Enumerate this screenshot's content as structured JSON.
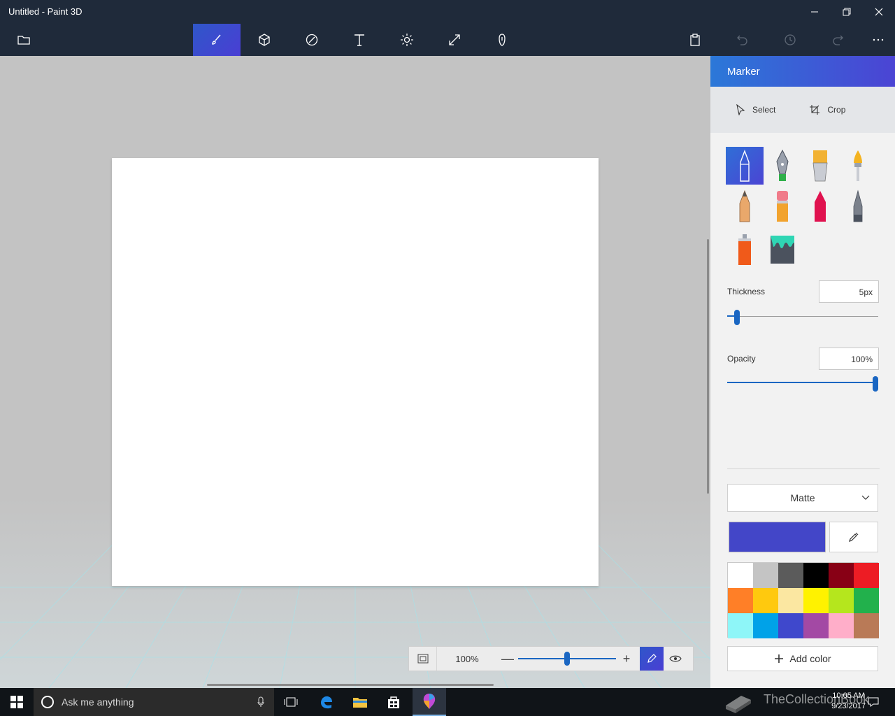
{
  "window": {
    "title": "Untitled - Paint 3D",
    "minimize_icon": "minimize-icon",
    "restore_icon": "restore-icon",
    "close_icon": "close-icon"
  },
  "toolbar": {
    "menu_icon": "folder-icon",
    "tools": [
      "brushes-icon",
      "3d-shapes-icon",
      "stickers-icon",
      "text-icon",
      "effects-icon",
      "canvas-icon",
      "remix3d-icon"
    ],
    "active_tool": "brushes-icon",
    "right_icons": [
      "paste-icon",
      "undo-icon",
      "history-icon",
      "redo-icon",
      "more-icon"
    ]
  },
  "zoom": {
    "value": "100%",
    "fit_icon": "fit-to-screen-icon",
    "minus": "—",
    "plus": "+",
    "level_fraction": 0.5
  },
  "panel": {
    "title": "Marker",
    "select_label": "Select",
    "crop_label": "Crop",
    "brushes": [
      "marker",
      "calligraphy-pen",
      "oil-brush",
      "watercolor",
      "pencil",
      "eraser",
      "crayon",
      "pixel-pen",
      "spray-can",
      "fill"
    ],
    "active_brush": "marker",
    "thickness_label": "Thickness",
    "thickness_value": "5px",
    "thickness_fraction": 0.05,
    "opacity_label": "Opacity",
    "opacity_value": "100%",
    "opacity_fraction": 1.0,
    "finish": "Matte",
    "current_color": "#4346c8",
    "palette": [
      "#ffffff",
      "#c4c4c4",
      "#5b5b5b",
      "#000000",
      "#880015",
      "#ed1c24",
      "#ff7f27",
      "#ffc90e",
      "#fbe7a1",
      "#fff200",
      "#b5e61d",
      "#22b14c",
      "#8ef6f8",
      "#00a2e8",
      "#3f48cc",
      "#a349a4",
      "#ffaec9",
      "#b97a57"
    ],
    "add_color_label": "Add color"
  },
  "taskbar": {
    "search_placeholder": "Ask me anything",
    "time": "10:05 AM",
    "date": "9/23/2017",
    "watermark": "TheCollectionBook"
  }
}
